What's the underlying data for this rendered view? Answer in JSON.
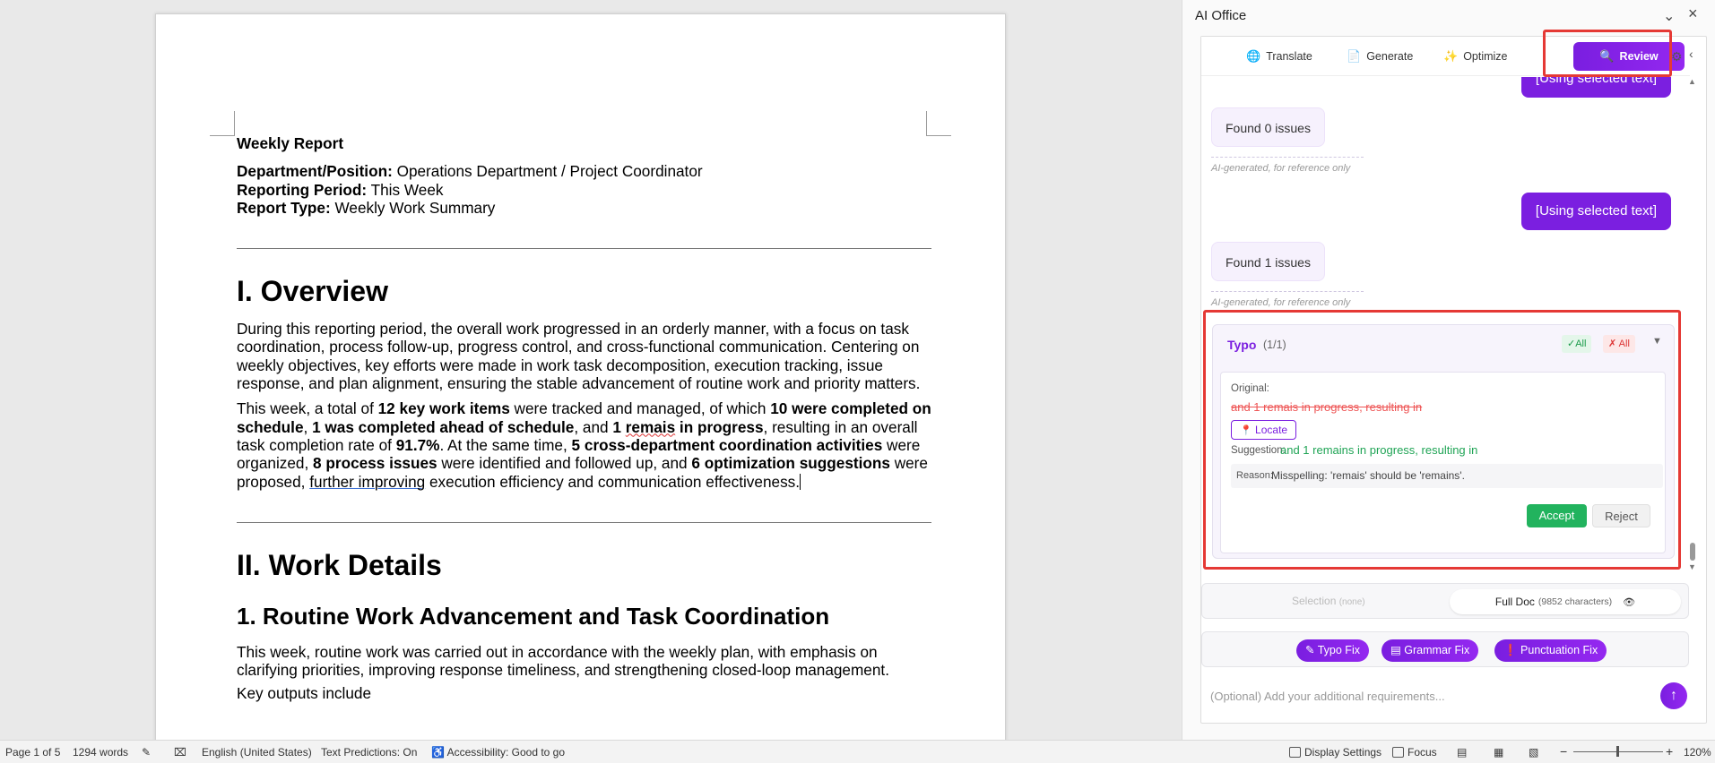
{
  "document": {
    "title": "Weekly Report",
    "meta": [
      {
        "label": "Department/Position:",
        "value": " Operations Department / Project Coordinator"
      },
      {
        "label": "Reporting Period:",
        "value": " This Week"
      },
      {
        "label": "Report Type:",
        "value": " Weekly Work Summary"
      }
    ],
    "h_overview": "I. Overview",
    "para1": "During this reporting period, the overall work progressed in an orderly manner, with a focus on task coordination, process follow-up, progress control, and cross-functional communication. Centering on weekly objectives, key efforts were made in work task decomposition, execution tracking, issue response, and plan alignment, ensuring the stable advancement of routine work and priority matters.",
    "para2": {
      "t1": "This week, a total of ",
      "b1": "12 key work items",
      "t2": " were tracked and managed, of which ",
      "b2": "10 were completed on schedule",
      "t3": ", ",
      "b3": "1 was completed ahead of schedule",
      "t4": ", and ",
      "b4a": "1 ",
      "b4b": "remais",
      "b4c": " in progress",
      "t5": ", resulting in an overall task completion rate of ",
      "b5": "91.7%",
      "t6": ". At the same time, ",
      "b6": "5 cross-department coordination activities",
      "t7": " were organized, ",
      "b7": "8 process issues",
      "t8": " were identified and followed up, and ",
      "b8": "6 optimization suggestions",
      "t9": " were proposed, ",
      "u1": "further improving",
      "t10": " execution efficiency and communication effectiveness."
    },
    "h_details": "II. Work Details",
    "h_routine": "1. Routine Work Advancement and Task Coordination",
    "para3": "This week, routine work was carried out in accordance with the weekly plan, with emphasis on clarifying priorities, improving response timeliness, and strengthening closed-loop management.",
    "para4": "Key outputs include"
  },
  "status_bar": {
    "page": "Page 1 of 5",
    "words": "1294 words",
    "language": "English (United States)",
    "text_predictions": "Text Predictions: On",
    "accessibility": "Accessibility: Good to go",
    "display_settings": "Display Settings",
    "focus": "Focus",
    "zoom_minus": "−",
    "zoom_plus": "+",
    "zoom": "120%"
  },
  "panel": {
    "title": "AI Office",
    "tabs": {
      "translate": "Translate",
      "generate": "Generate",
      "optimize": "Optimize",
      "review": "Review"
    },
    "messages": {
      "user1": "[Using selected text]",
      "bot1": "Found 0 issues",
      "note1": "AI-generated, for reference only",
      "user2": "[Using selected text]",
      "bot2": "Found 1 issues",
      "note2": "AI-generated, for reference only"
    },
    "issue": {
      "type": "Typo",
      "count": "(1/1)",
      "accept_all": "✓All",
      "reject_all": "✗ All",
      "original_label": "Original:",
      "original_text": "and 1 remais in progress, resulting in",
      "locate": "Locate",
      "suggestion_label": "Suggestion:",
      "suggestion_text": "and 1 remains in progress, resulting in",
      "reason_label": "Reason:",
      "reason_text": "Misspelling: 'remais' should be 'remains'.",
      "accept": "Accept",
      "reject": "Reject"
    },
    "scope": {
      "selection": "Selection",
      "selection_note": "(none)",
      "full_doc": "Full Doc",
      "full_doc_count": "(9852 characters)"
    },
    "quick_actions": {
      "typo": "Typo Fix",
      "grammar": "Grammar Fix",
      "punctuation": "Punctuation Fix"
    },
    "input_placeholder": "(Optional) Add your additional requirements..."
  },
  "icons": {
    "translate": "globe-icon",
    "generate": "document-icon",
    "optimize": "sparkle-icon",
    "review": "magnifier-icon",
    "settings": "gear-icon",
    "collapse": "chevron-left-icon",
    "locate": "pin-icon",
    "visibility": "eye-icon",
    "send": "arrow-up-icon"
  },
  "colors": {
    "accent": "#7b1fe0",
    "accept": "#22b35e",
    "highlight": "#e53935",
    "error": "#e55555",
    "success": "#1fa455"
  }
}
